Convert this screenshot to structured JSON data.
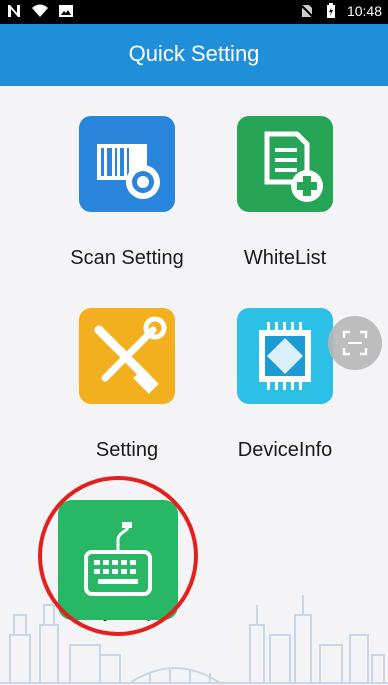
{
  "status_bar": {
    "time": "10:48"
  },
  "header": {
    "title": "Quick Setting"
  },
  "tiles": [
    {
      "label": "Scan Setting",
      "icon": "barcode-gear-icon",
      "color": "#2a86dc"
    },
    {
      "label": "WhiteList",
      "icon": "checklist-add-icon",
      "color": "#27a556"
    },
    {
      "label": "Setting",
      "icon": "wrench-screwdriver-icon",
      "color": "#f2b01e"
    },
    {
      "label": "DeviceInfo",
      "icon": "chip-icon",
      "color": "#2dc0e6"
    },
    {
      "label": "Key map",
      "icon": "keyboard-icon",
      "color": "#28b764"
    }
  ],
  "annotation": {
    "color": "#e41f1f",
    "target": "Key map"
  }
}
